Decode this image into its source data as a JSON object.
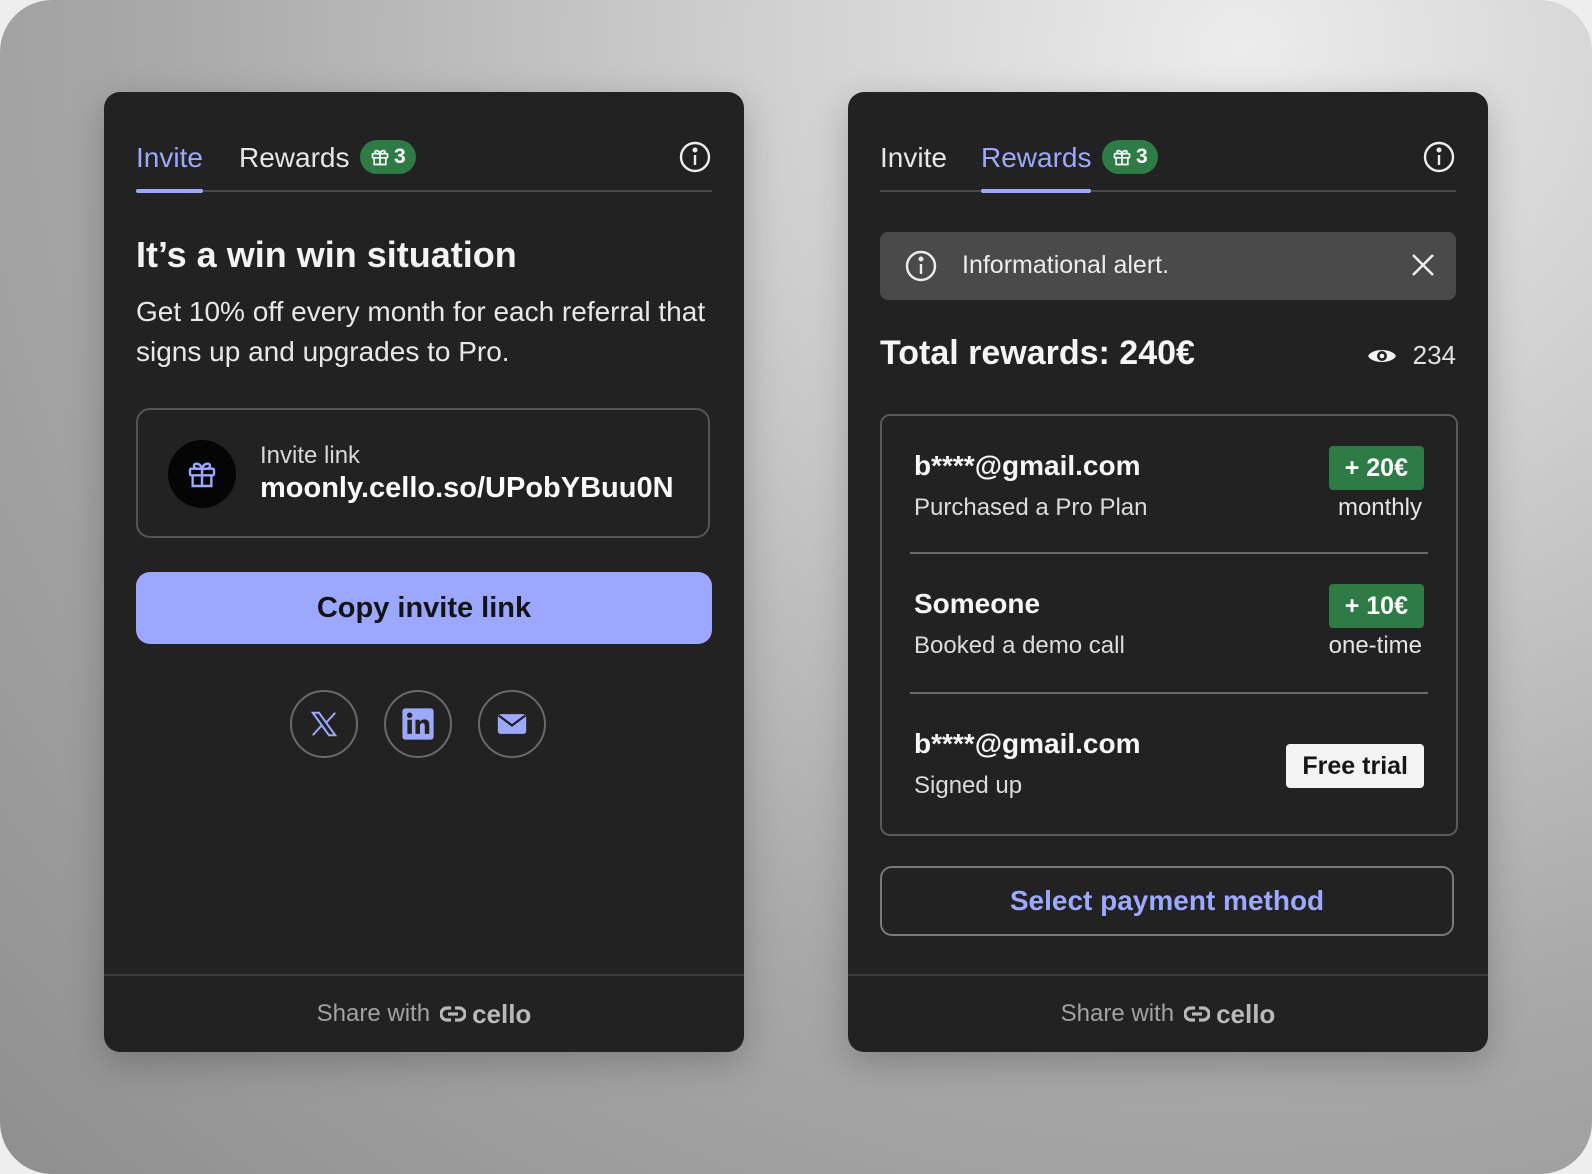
{
  "left_panel": {
    "tabs": {
      "invite": "Invite",
      "rewards": "Rewards",
      "badge_count": "3"
    },
    "headline": "It’s a win win situation",
    "description": "Get 10% off every month for each referral that signs up and upgrades to Pro.",
    "invite_link": {
      "label": "Invite link",
      "value": "moonly.cello.so/UPobYBuu0N"
    },
    "copy_button": "Copy invite link",
    "share_icons": [
      "x-icon",
      "linkedin-icon",
      "mail-icon"
    ],
    "footer": {
      "text": "Share with",
      "brand": "cello"
    }
  },
  "right_panel": {
    "tabs": {
      "invite": "Invite",
      "rewards": "Rewards",
      "badge_count": "3"
    },
    "alert": "Informational alert.",
    "total_rewards": "Total rewards: 240€",
    "views": "234",
    "rewards": [
      {
        "name": "b****@gmail.com",
        "action": "Purchased a Pro Plan",
        "amount": "+ 20€",
        "frequency": "monthly"
      },
      {
        "name": "Someone",
        "action": "Booked a demo call",
        "amount": "+ 10€",
        "frequency": "one-time"
      },
      {
        "name": "b****@gmail.com",
        "action": "Signed up",
        "status": "Free trial"
      }
    ],
    "pay_button": "Select payment method",
    "footer": {
      "text": "Share with",
      "brand": "cello"
    }
  },
  "colors": {
    "accent": "#9ca8ff",
    "card_bg": "#222222",
    "badge_green": "#2f7b46"
  }
}
